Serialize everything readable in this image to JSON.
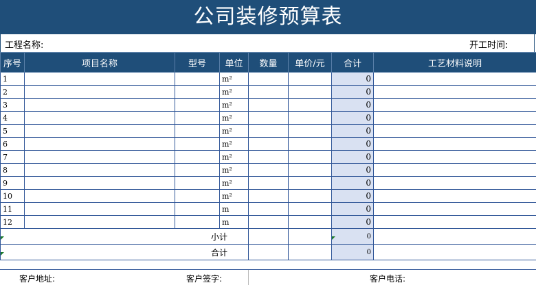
{
  "title": "公司装修预算表",
  "info": {
    "project_label": "工程名称:",
    "start_label": "开工时间:"
  },
  "columns": [
    "序号",
    "项目名称",
    "型号",
    "单位",
    "数量",
    "单价/元",
    "合计",
    "工艺材料说明"
  ],
  "rows": [
    {
      "no": "1",
      "unit": "m²",
      "total": "0"
    },
    {
      "no": "2",
      "unit": "m²",
      "total": "0"
    },
    {
      "no": "3",
      "unit": "m²",
      "total": "0"
    },
    {
      "no": "4",
      "unit": "m²",
      "total": "0"
    },
    {
      "no": "5",
      "unit": "m²",
      "total": "0"
    },
    {
      "no": "6",
      "unit": "m²",
      "total": "0"
    },
    {
      "no": "7",
      "unit": "m²",
      "total": "0"
    },
    {
      "no": "8",
      "unit": "m²",
      "total": "0"
    },
    {
      "no": "9",
      "unit": "m²",
      "total": "0"
    },
    {
      "no": "10",
      "unit": "m²",
      "total": "0"
    },
    {
      "no": "11",
      "unit": "m",
      "total": "0"
    },
    {
      "no": "12",
      "unit": "m",
      "total": "0"
    }
  ],
  "subtotal": {
    "label": "小计",
    "value": "0"
  },
  "grand_total": {
    "label": "合计",
    "value": "0"
  },
  "footer": {
    "address_label": "客户地址:",
    "signature_label": "客户签字:",
    "phone_label": "客户电话:"
  }
}
